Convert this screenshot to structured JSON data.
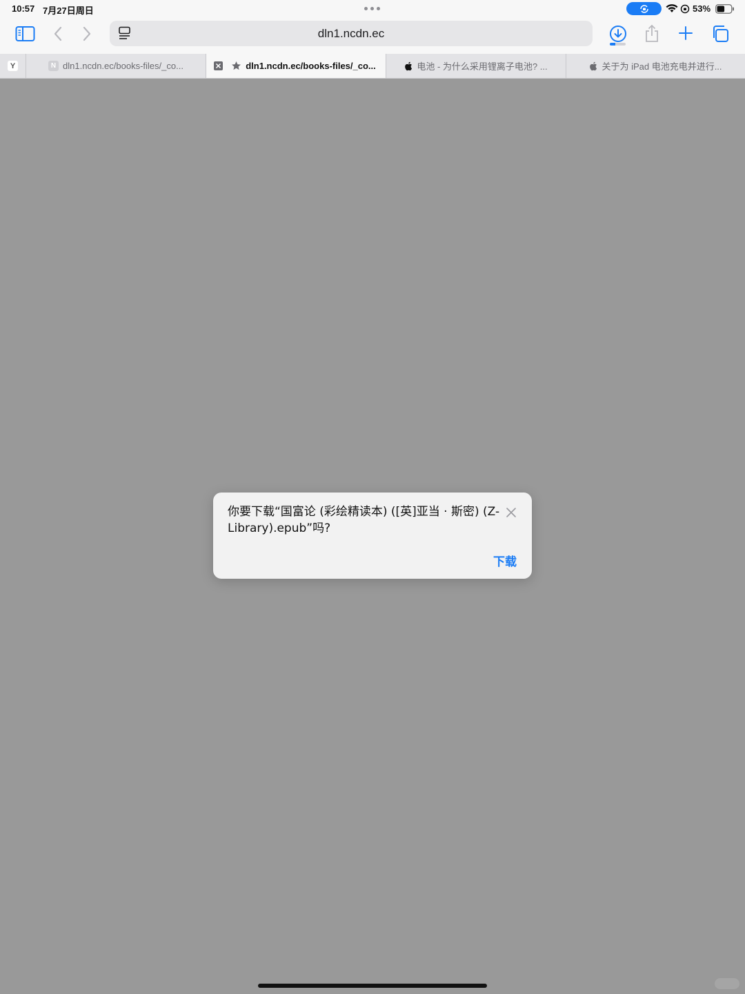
{
  "status_bar": {
    "time": "10:57",
    "date": "7月27日周日",
    "battery_percent": "53%",
    "battery_level": 0.53
  },
  "toolbar": {
    "address": "dln1.ncdn.ec",
    "download_progress": 0.35
  },
  "tabs": {
    "pinned_icon": "Y",
    "items": [
      {
        "title": "dln1.ncdn.ec/books-files/_co...",
        "favicon": "N",
        "active": false
      },
      {
        "title": "dln1.ncdn.ec/books-files/_co...",
        "favicon": "star-icon",
        "active": true
      },
      {
        "title": "电池 - 为什么采用锂离子电池? ...",
        "favicon": "apple-icon",
        "active": false
      },
      {
        "title": "关于为 iPad 电池充电并进行...",
        "favicon": "apple-icon",
        "active": false
      }
    ]
  },
  "dialog": {
    "message": "你要下载“国富论 (彩绘精读本) ([英]亚当 · 斯密) (Z-Library).epub”吗?",
    "download_button": "下载"
  },
  "colors": {
    "accent": "#1a7cf5",
    "page_background": "#999999"
  }
}
